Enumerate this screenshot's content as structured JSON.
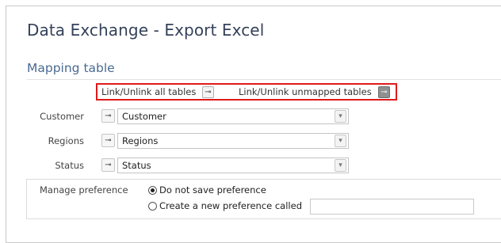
{
  "app": {
    "title": "Data Exchange - Export Excel"
  },
  "mapping": {
    "section_title": "Mapping table",
    "link_all_label": "Link/Unlink all tables",
    "link_unmapped_label": "Link/Unlink unmapped tables",
    "plug_glyph": "⊸"
  },
  "rows": [
    {
      "label": "Customer",
      "value": "Customer"
    },
    {
      "label": "Regions",
      "value": "Regions"
    },
    {
      "label": "Status",
      "value": "Status"
    }
  ],
  "preference": {
    "label": "Manage preference",
    "options": [
      {
        "label": "Do not save preference",
        "selected": true
      },
      {
        "label": "Create a new preference called",
        "selected": false
      }
    ],
    "new_name_value": ""
  },
  "icons": {
    "dropdown": "chevron-down-icon",
    "plug": "plug-icon"
  },
  "colors": {
    "highlight_border": "#e01a1a",
    "title": "#35415a",
    "section_title": "#4a6a92"
  }
}
